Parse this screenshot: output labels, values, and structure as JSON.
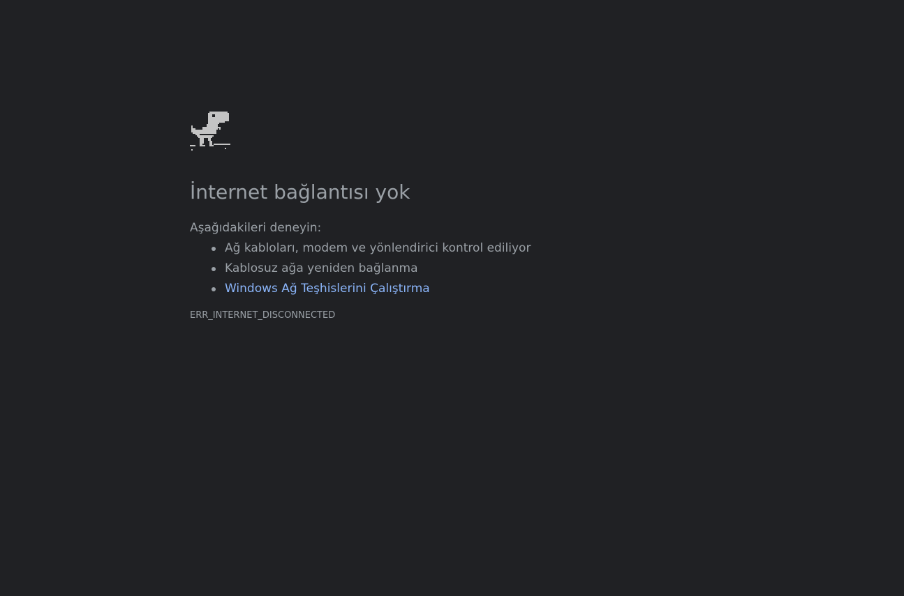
{
  "error_page": {
    "icon": "offline-dinosaur-icon",
    "title": "İnternet bağlantısı yok",
    "suggestions_heading": "Aşağıdakileri deneyin:",
    "suggestions": [
      {
        "label": "Ağ kabloları, modem ve yönlendirici kontrol ediliyor",
        "is_link": false
      },
      {
        "label": "Kablosuz ağa yeniden bağlanma",
        "is_link": false
      },
      {
        "label": "Windows Ağ Teşhislerini Çalıştırma",
        "is_link": true
      }
    ],
    "error_code": "ERR_INTERNET_DISCONNECTED"
  },
  "colors": {
    "background": "#202124",
    "text": "#9aa0a6",
    "link": "#8ab4f8",
    "dino": "#c4c4c4"
  }
}
